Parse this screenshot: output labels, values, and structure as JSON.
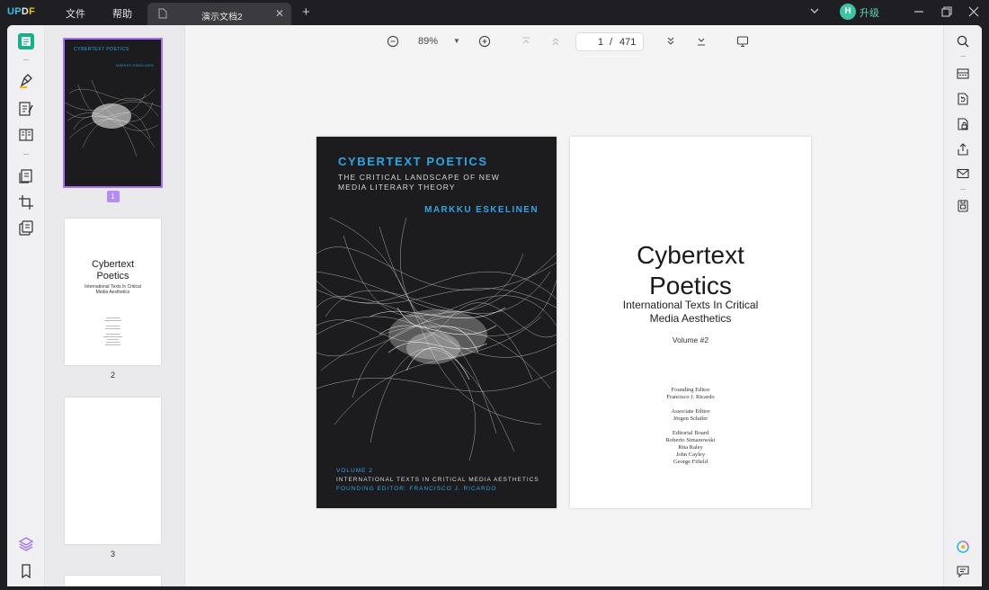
{
  "titlebar": {
    "logo": {
      "part1": "UP",
      "part2": "D",
      "part3": "F"
    },
    "menu": [
      "文件",
      "帮助"
    ],
    "tab": {
      "label": "演示文档2"
    },
    "upgrade": {
      "avatar_letter": "H",
      "label": "升级"
    }
  },
  "toolbar": {
    "zoom": "89%",
    "page_current": "1",
    "page_separator": "/",
    "page_total": "471"
  },
  "thumbnails": [
    {
      "number": "1",
      "selected": true
    },
    {
      "number": "2",
      "selected": false
    },
    {
      "number": "3",
      "selected": false
    }
  ],
  "thumb2": {
    "title": "Cybertext Poetics",
    "subtitle": "International Texts In Critical Media Aesthetics"
  },
  "cover": {
    "title": "CYBERTEXT POETICS",
    "subtitle": "THE CRITICAL LANDSCAPE OF NEW MEDIA LITERARY THEORY",
    "author": "MARKKU ESKELINEN",
    "volume": "VOLUME 2",
    "series": "INTERNATIONAL TEXTS IN CRITICAL MEDIA AESTHETICS",
    "editor": "FOUNDING EDITOR: FRANCISCO J. RICARDO"
  },
  "title_page": {
    "title_line1": "Cybertext",
    "title_line2": "Poetics",
    "subtitle_line1": "International Texts In Critical",
    "subtitle_line2": "Media Aesthetics",
    "volume": "Volume #2",
    "credits": {
      "founding_label": "Founding Editor",
      "founding_name": "Francisco J. Ricardo",
      "associate_label": "Associate Editor",
      "associate_name": "Jörgen Schäfer",
      "board_label": "Editorial Board",
      "board": [
        "Roberto Simanowski",
        "Rita Raley",
        "John Cayley",
        "George Fifield"
      ]
    }
  },
  "colors": {
    "accent": "#a472f2",
    "cover_blue": "#2da6e2",
    "upgrade": "#3fc3a5"
  }
}
